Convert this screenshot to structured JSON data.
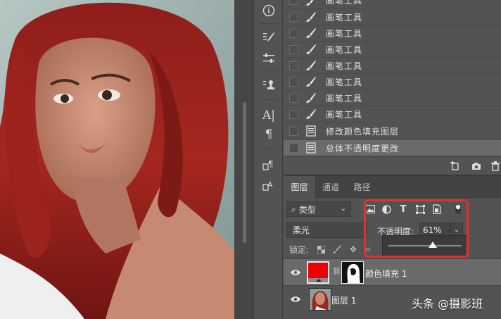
{
  "history": {
    "items": [
      {
        "label": "画笔工具",
        "icon": "brush-icon"
      },
      {
        "label": "画笔工具",
        "icon": "brush-icon"
      },
      {
        "label": "画笔工具",
        "icon": "brush-icon"
      },
      {
        "label": "画笔工具",
        "icon": "brush-icon"
      },
      {
        "label": "画笔工具",
        "icon": "brush-icon"
      },
      {
        "label": "画笔工具",
        "icon": "brush-icon"
      },
      {
        "label": "画笔工具",
        "icon": "brush-icon"
      },
      {
        "label": "画笔工具",
        "icon": "brush-icon"
      },
      {
        "label": "修改颜色填充图层",
        "icon": "document-icon"
      },
      {
        "label": "总体不透明度更改",
        "icon": "document-icon"
      }
    ],
    "selected_index": 9
  },
  "layers_panel": {
    "tabs": [
      "图层",
      "通道",
      "路径"
    ],
    "active_tab": "图层",
    "filter": {
      "icon": "search-icon",
      "kind": "类型"
    },
    "blend_mode": "柔光",
    "opacity_label": "不透明度:",
    "opacity_value": "61%",
    "opacity_fraction": 0.61,
    "lock_label": "锁定:",
    "layers": [
      {
        "name": "颜色填充 1",
        "type": "fill",
        "fill_color": "#ee0000",
        "selected": true
      },
      {
        "name": "图层 1",
        "type": "pixel",
        "selected": false
      }
    ]
  },
  "tools": [
    "info-icon",
    "brush-settings-icon",
    "adjust-sliders-icon",
    "clone-source-icon",
    "character-icon",
    "paragraph-icon",
    "paragraph-styles-icon",
    "character-styles-icon"
  ],
  "tool_glyphs": {
    "character": "A|",
    "paragraph": "¶"
  },
  "colors": {
    "accent_highlight": "#e53025",
    "panel_bg": "#535353",
    "fill_color": "#ee0000"
  },
  "watermark": "头条 @摄影班"
}
